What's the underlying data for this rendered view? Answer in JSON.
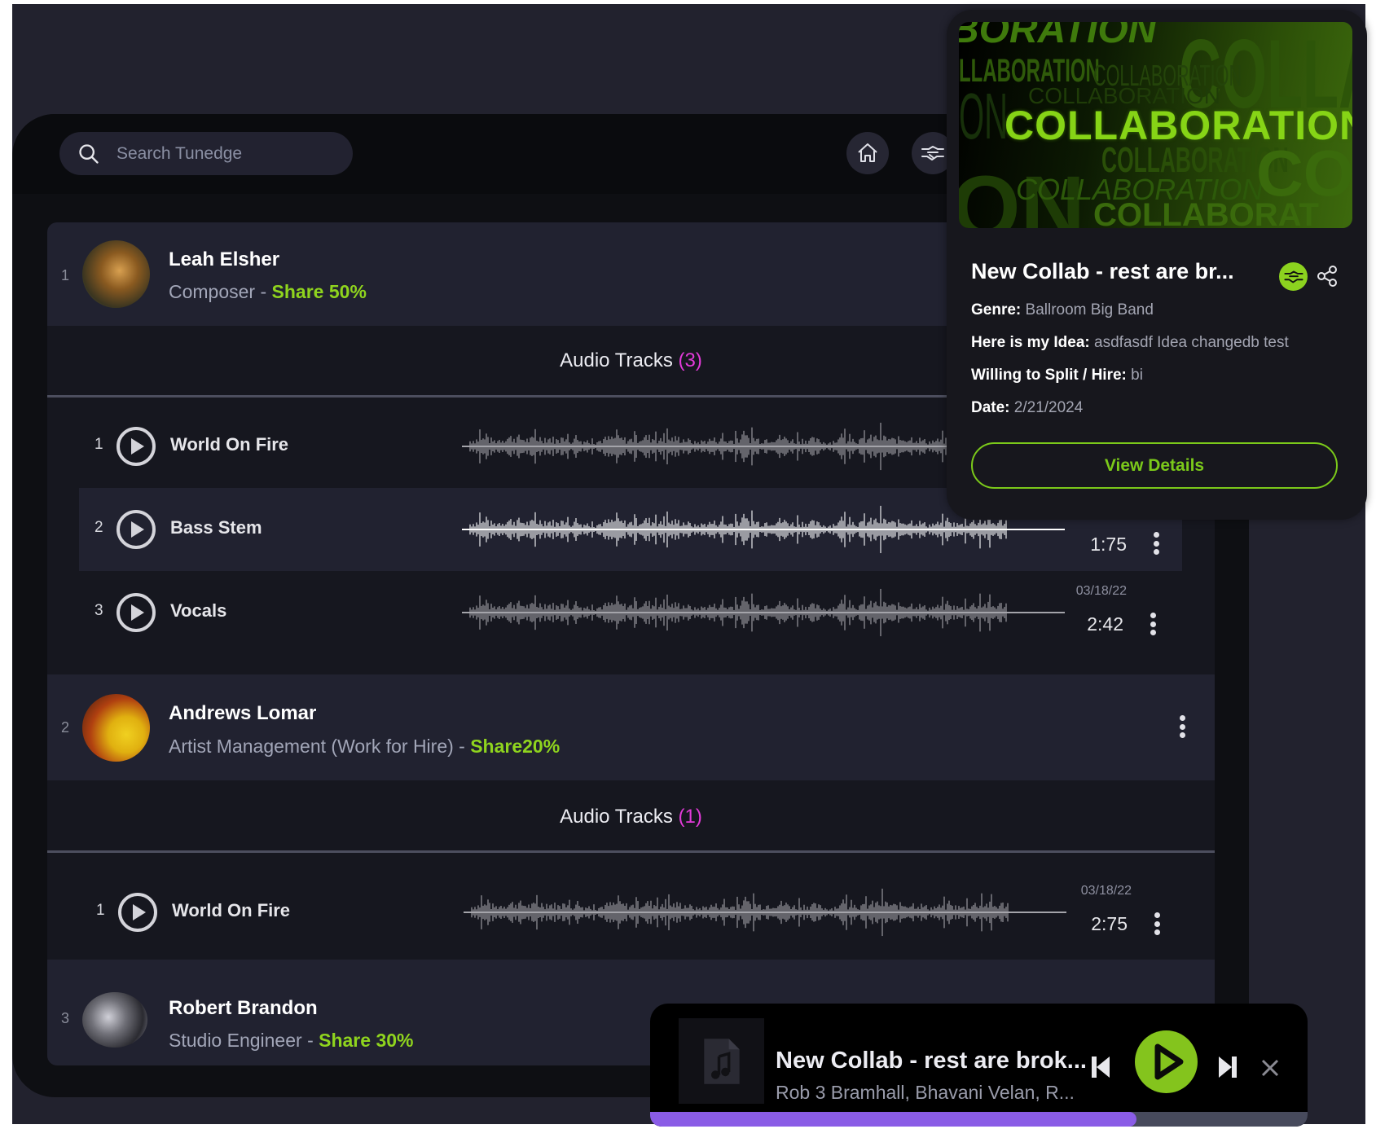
{
  "search": {
    "placeholder": "Search Tunedge"
  },
  "header": {
    "icons": [
      "home-icon",
      "collab-handshake-icon"
    ]
  },
  "collaborators": [
    {
      "index": "1",
      "name": "Leah Elsher",
      "role": "Composer - ",
      "share": "Share 50%",
      "audio_title": "Audio Tracks ",
      "audio_count": "(3)",
      "tracks": [
        {
          "index": "1",
          "name": "World On Fire",
          "date": "",
          "duration": ""
        },
        {
          "index": "2",
          "name": "Bass Stem",
          "date": "",
          "duration": "1:75",
          "highlighted": true
        },
        {
          "index": "3",
          "name": "Vocals",
          "date": "03/18/22",
          "duration": "2:42"
        }
      ]
    },
    {
      "index": "2",
      "name": "Andrews Lomar",
      "role": "Artist Management (Work for Hire) - ",
      "share": "Share20%",
      "audio_title": "Audio Tracks ",
      "audio_count": "(1)",
      "tracks": [
        {
          "index": "1",
          "name": "World On Fire",
          "date": "03/18/22",
          "duration": "2:75"
        }
      ]
    },
    {
      "index": "3",
      "name": "Robert Brandon",
      "role": "Studio Engineer - ",
      "share": "Share 30%"
    }
  ],
  "popup": {
    "banner_text": "COLLABORATION",
    "title": "New Collab - rest are br...",
    "genre_label": "Genre:",
    "genre": " Ballroom Big Band",
    "idea_label": "Here is my Idea:",
    "idea": " asdfasdf Idea changedb test",
    "split_label": "Willing to Split / Hire:",
    "split": " bi",
    "date_label": "Date:",
    "date": " 2/21/2024",
    "view_details": "View Details"
  },
  "player": {
    "title": "New Collab - rest are brok...",
    "subtitle": "Rob 3 Bramhall, Bhavani Velan, R...",
    "progress_percent": 74
  },
  "colors": {
    "accent_green": "#8fd41e",
    "count_magenta": "#e23ad8",
    "progress_purple": "#8a5ce6",
    "page_bg": "#22222e"
  }
}
